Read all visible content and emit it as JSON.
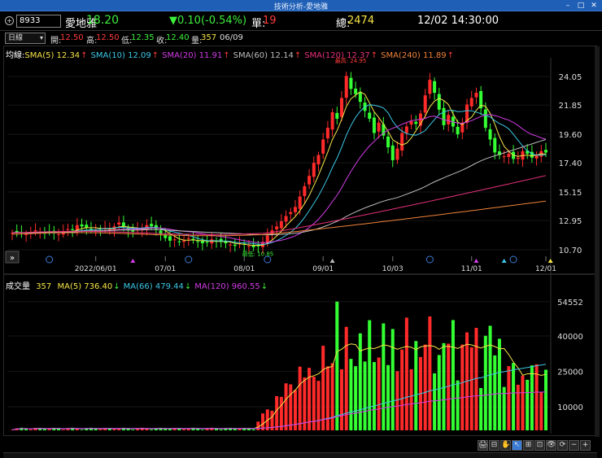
{
  "window": {
    "title": "技術分析-愛地雅"
  },
  "quote": {
    "code": "8933",
    "name": "愛地雅",
    "price": "18.20",
    "change": "▼0.10(-0.54%)",
    "single_label": "單:",
    "single_value": "19",
    "total_label": "總:",
    "total_value": "2474",
    "datetime": "12/02 14:30:00"
  },
  "ohlc": {
    "period": "日線",
    "open_label": "開:",
    "open": "12.50",
    "high_label": "高:",
    "high": "12.50",
    "low_label": "低:",
    "low": "12.35",
    "close_label": "收:",
    "close": "12.40",
    "vol_label": "量:",
    "vol": "357",
    "date": "06/09"
  },
  "price_legend": {
    "prefix": "均線:",
    "items": [
      {
        "label": "SMA(5) 12.34",
        "arrow": "↑",
        "color": "#f5e447"
      },
      {
        "label": "SMA(10) 12.09",
        "arrow": "↑",
        "color": "#3cc7e6"
      },
      {
        "label": "SMA(20) 11.91",
        "arrow": "↑",
        "color": "#d23ce6"
      },
      {
        "label": "SMA(60) 12.14",
        "arrow": "↑",
        "color": "#bdbdbd"
      },
      {
        "label": "SMA(120) 12.37",
        "arrow": "↑",
        "color": "#e6307a"
      },
      {
        "label": "SMA(240) 11.89",
        "arrow": "↑",
        "color": "#f0823a"
      }
    ]
  },
  "volume_legend": {
    "prefix": "成交量",
    "value": "357",
    "items": [
      {
        "label": "MA(5) 736.40",
        "arrow": "↓",
        "color": "#f5e447"
      },
      {
        "label": "MA(66) 479.44",
        "arrow": "↓",
        "color": "#3cc7e6"
      },
      {
        "label": "MA(120) 960.55",
        "arrow": "↓",
        "color": "#d23ce6"
      }
    ]
  },
  "annotations": {
    "high": "最高: 24.95",
    "low": "最低: 10.85"
  },
  "toolbar": [
    "🖨",
    "⊟",
    "✋",
    "↖",
    "⊞",
    "⊡",
    "👁",
    "⟳",
    "−",
    "+"
  ],
  "chart_data": [
    {
      "type": "candlestick",
      "ylim": [
        10.2,
        25.5
      ],
      "y_ticks": [
        "24.05",
        "21.85",
        "19.60",
        "17.40",
        "15.15",
        "12.95",
        "10.70"
      ],
      "x_ticks": [
        "2022/06/01",
        "07/01",
        "08/01",
        "09/01",
        "10/03",
        "11/01",
        "12/01"
      ],
      "close_series": [
        12.0,
        12.1,
        12.0,
        11.9,
        12.0,
        12.2,
        12.1,
        12.0,
        12.1,
        12.0,
        11.9,
        12.1,
        12.3,
        12.2,
        12.6,
        12.5,
        12.4,
        12.3,
        12.2,
        12.3,
        12.4,
        12.3,
        12.5,
        12.8,
        12.5,
        12.2,
        12.1,
        12.3,
        12.4,
        12.6,
        12.5,
        12.3,
        11.9,
        11.6,
        11.4,
        11.5,
        11.3,
        11.4,
        11.6,
        11.5,
        11.3,
        11.2,
        11.3,
        11.5,
        11.4,
        11.3,
        11.2,
        11.1,
        11.0,
        11.2,
        11.1,
        11.0,
        10.9,
        11.0,
        11.3,
        11.8,
        12.2,
        12.5,
        12.9,
        13.3,
        13.6,
        14.0,
        14.8,
        15.6,
        16.4,
        17.4,
        18.0,
        19.2,
        20.1,
        21.3,
        20.8,
        22.4,
        24.1,
        23.1,
        22.7,
        22.1,
        21.4,
        20.8,
        19.7,
        20.5,
        19.5,
        18.6,
        17.6,
        18.5,
        19.7,
        20.2,
        20.6,
        20.4,
        21.2,
        22.6,
        23.8,
        22.8,
        21.5,
        20.3,
        21.1,
        20.2,
        19.6,
        20.5,
        21.9,
        22.4,
        22.8,
        21.6,
        20.1,
        19.2,
        18.2,
        18.0,
        17.9,
        18.1,
        17.7,
        17.8,
        18.3,
        18.1,
        17.8,
        18.0,
        18.3,
        18.2
      ],
      "volume_ylim": [
        0,
        60000
      ],
      "volume_ticks": [
        "54552",
        "40000",
        "25000",
        "10000"
      ]
    }
  ]
}
